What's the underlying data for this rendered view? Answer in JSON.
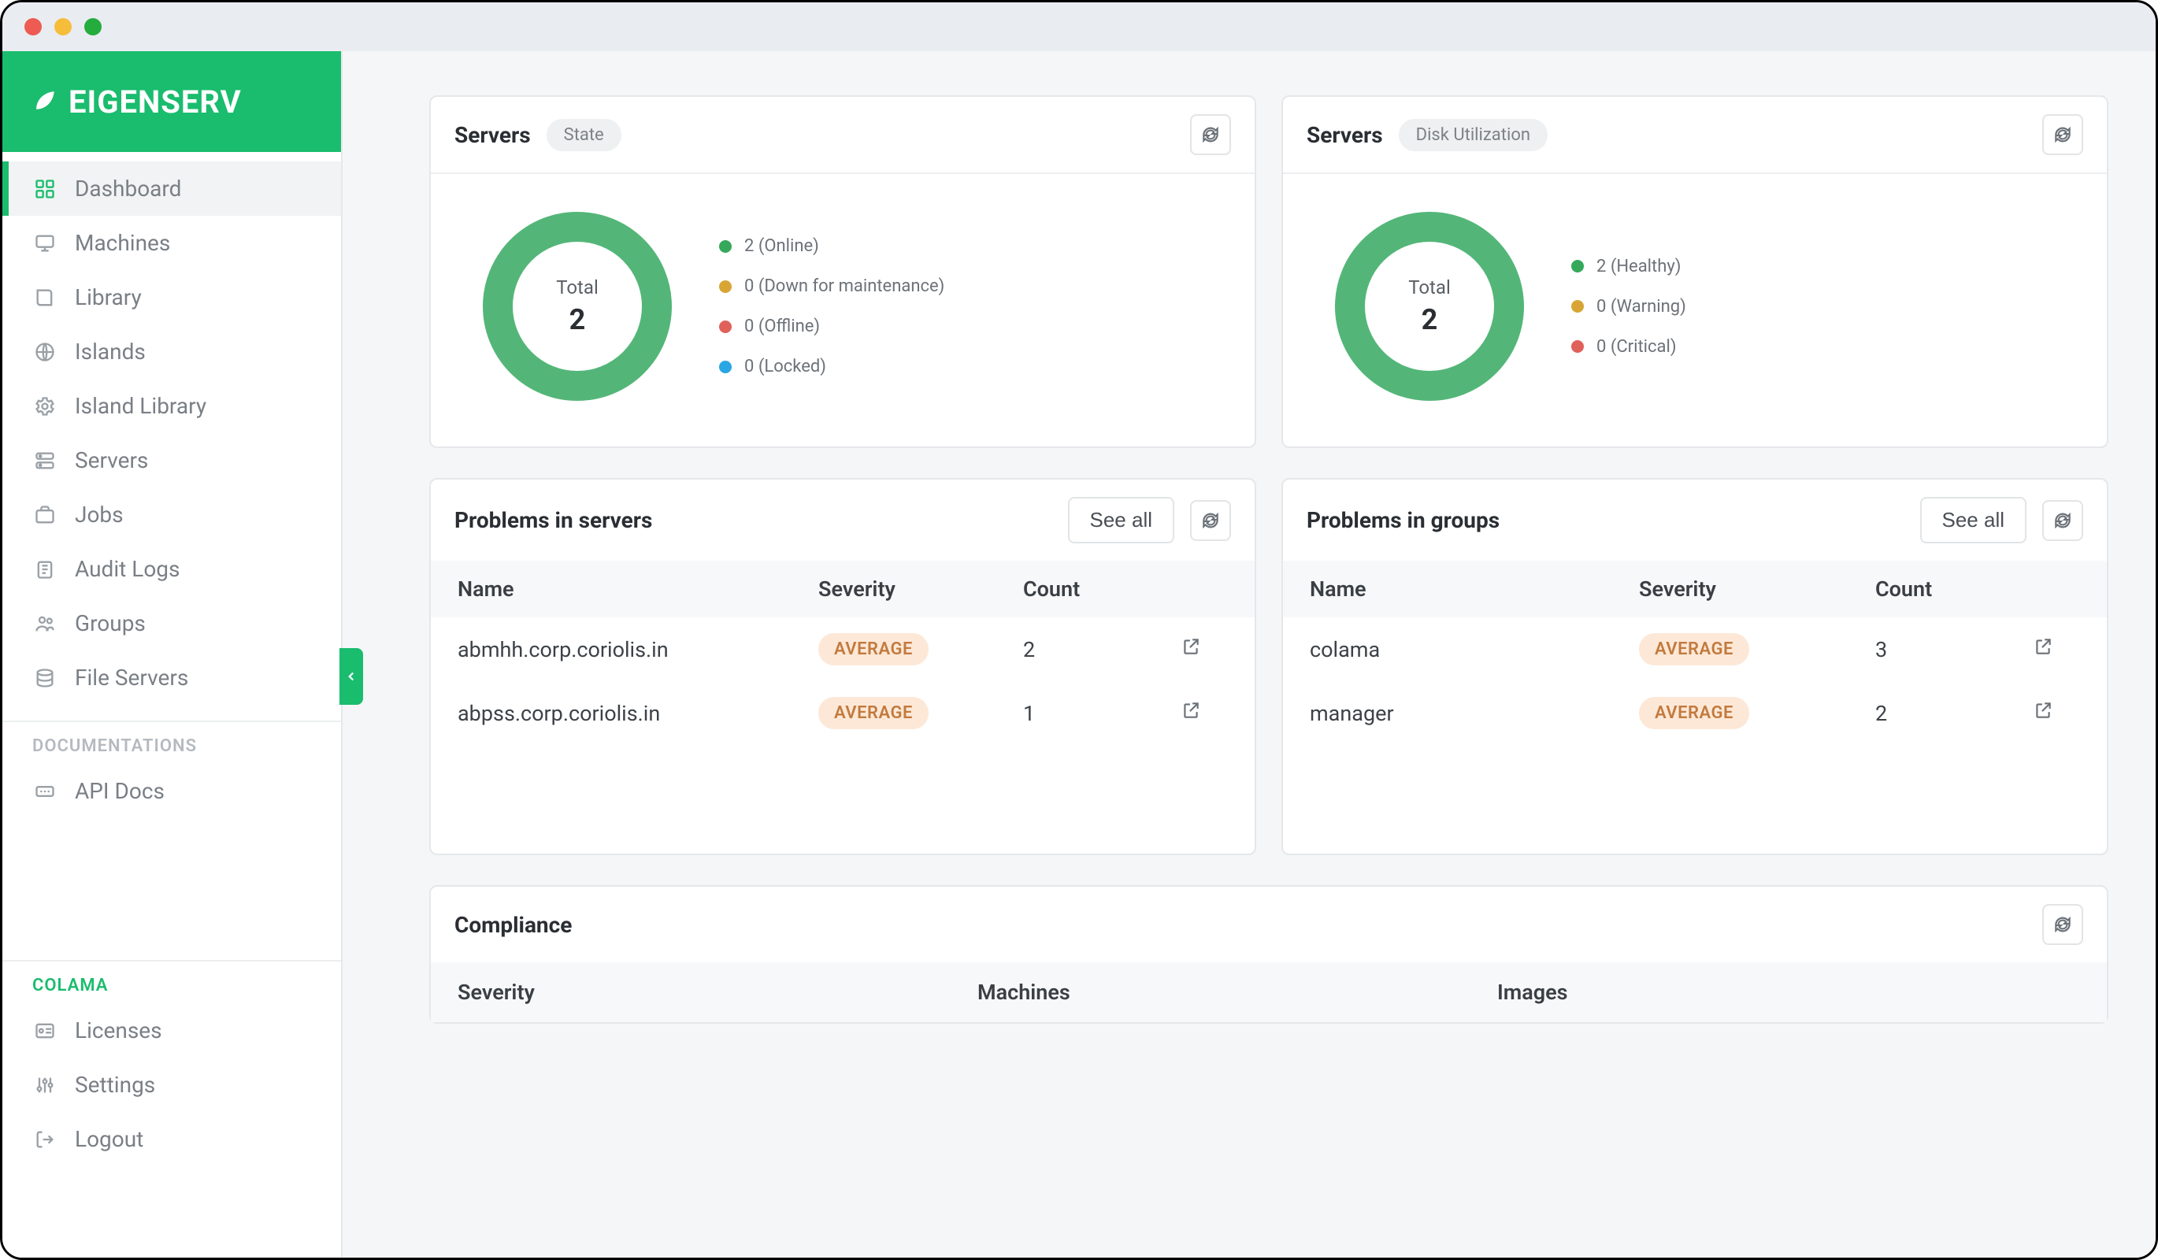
{
  "brand": "EIGENSERV",
  "sidebar": {
    "items": [
      {
        "label": "Dashboard"
      },
      {
        "label": "Machines"
      },
      {
        "label": "Library"
      },
      {
        "label": "Islands"
      },
      {
        "label": "Island Library"
      },
      {
        "label": "Servers"
      },
      {
        "label": "Jobs"
      },
      {
        "label": "Audit Logs"
      },
      {
        "label": "Groups"
      },
      {
        "label": "File Servers"
      }
    ],
    "section_docs": "DOCUMENTATIONS",
    "api_docs": "API Docs",
    "section_colama": "COLAMA",
    "bottom": [
      {
        "label": "Licenses"
      },
      {
        "label": "Settings"
      },
      {
        "label": "Logout"
      }
    ]
  },
  "cards": {
    "state": {
      "title": "Servers",
      "pill": "State",
      "total_label": "Total",
      "total": "2",
      "legend": [
        {
          "color": "#36a85b",
          "text": "2 (Online)"
        },
        {
          "color": "#d8a534",
          "text": "0 (Down for maintenance)"
        },
        {
          "color": "#e0615a",
          "text": "0 (Offline)"
        },
        {
          "color": "#2aa6e3",
          "text": "0 (Locked)"
        }
      ]
    },
    "disk": {
      "title": "Servers",
      "pill": "Disk Utilization",
      "total_label": "Total",
      "total": "2",
      "legend": [
        {
          "color": "#36a85b",
          "text": "2 (Healthy)"
        },
        {
          "color": "#d8a534",
          "text": "0 (Warning)"
        },
        {
          "color": "#e0615a",
          "text": "0 (Critical)"
        }
      ]
    },
    "problems_servers": {
      "title": "Problems in servers",
      "see_all": "See all",
      "cols": {
        "name": "Name",
        "severity": "Severity",
        "count": "Count"
      },
      "rows": [
        {
          "name": "abmhh.corp.coriolis.in",
          "severity": "AVERAGE",
          "count": "2"
        },
        {
          "name": "abpss.corp.coriolis.in",
          "severity": "AVERAGE",
          "count": "1"
        }
      ]
    },
    "problems_groups": {
      "title": "Problems in groups",
      "see_all": "See all",
      "cols": {
        "name": "Name",
        "severity": "Severity",
        "count": "Count"
      },
      "rows": [
        {
          "name": "colama",
          "severity": "AVERAGE",
          "count": "3"
        },
        {
          "name": "manager",
          "severity": "AVERAGE",
          "count": "2"
        }
      ]
    },
    "compliance": {
      "title": "Compliance",
      "cols": {
        "severity": "Severity",
        "machines": "Machines",
        "images": "Images"
      }
    }
  },
  "chart_data": [
    {
      "type": "pie",
      "title": "Servers — State",
      "total": 2,
      "series": [
        {
          "name": "Online",
          "value": 2,
          "color": "#36a85b"
        },
        {
          "name": "Down for maintenance",
          "value": 0,
          "color": "#d8a534"
        },
        {
          "name": "Offline",
          "value": 0,
          "color": "#e0615a"
        },
        {
          "name": "Locked",
          "value": 0,
          "color": "#2aa6e3"
        }
      ]
    },
    {
      "type": "pie",
      "title": "Servers — Disk Utilization",
      "total": 2,
      "series": [
        {
          "name": "Healthy",
          "value": 2,
          "color": "#36a85b"
        },
        {
          "name": "Warning",
          "value": 0,
          "color": "#d8a534"
        },
        {
          "name": "Critical",
          "value": 0,
          "color": "#e0615a"
        }
      ]
    }
  ]
}
